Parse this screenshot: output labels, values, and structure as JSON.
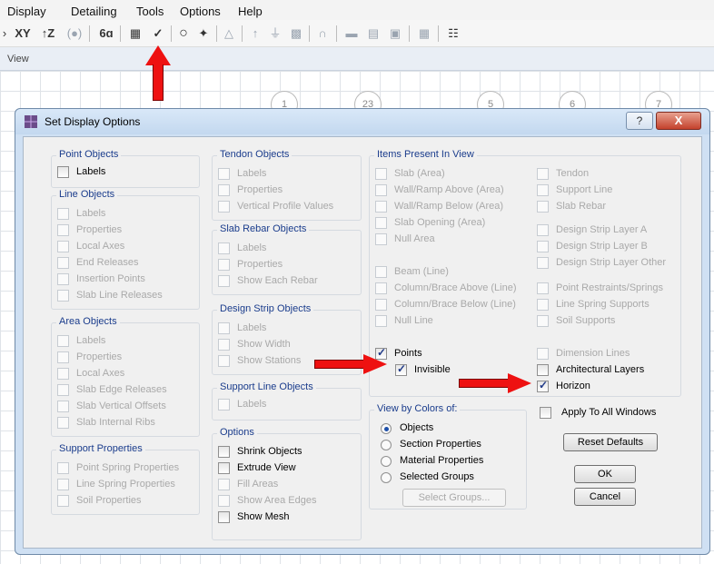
{
  "menubar": [
    "Display",
    "Detailing",
    "Tools",
    "Options",
    "Help"
  ],
  "toolbar": {
    "text_buttons": [
      "XY",
      "↑Z",
      "(●)",
      "6ɑ",
      "✓"
    ],
    "icons": [
      "pan-icon",
      "xy-view-icon",
      "z-view-icon",
      "perspective-icon",
      "rubber-band-icon",
      "display-options-icon",
      "set-display-options-icon",
      "circle-icon",
      "draw-point-icon",
      "triangle-icon",
      "column-icon",
      "beam-icon",
      "wall-icon",
      "slab-icon",
      "strip-icon",
      "rebar-icon",
      "grid-icon",
      "table-icon"
    ]
  },
  "view": {
    "title": "View"
  },
  "grid_bubbles": [
    "1",
    "23",
    "5",
    "6",
    "7"
  ],
  "dialog": {
    "title": "Set Display Options",
    "help_label": "?",
    "close_label": "X",
    "point_objects": {
      "title": "Point Objects",
      "items": [
        {
          "label": "Labels",
          "checked": false,
          "enabled": true
        }
      ]
    },
    "line_objects": {
      "title": "Line Objects",
      "items": [
        {
          "label": "Labels",
          "checked": false,
          "enabled": false
        },
        {
          "label": "Properties",
          "checked": false,
          "enabled": false
        },
        {
          "label": "Local Axes",
          "checked": false,
          "enabled": false
        },
        {
          "label": "End Releases",
          "checked": false,
          "enabled": false
        },
        {
          "label": "Insertion Points",
          "checked": false,
          "enabled": false
        },
        {
          "label": "Slab Line Releases",
          "checked": false,
          "enabled": false
        }
      ]
    },
    "area_objects": {
      "title": "Area Objects",
      "items": [
        {
          "label": "Labels",
          "checked": false,
          "enabled": false
        },
        {
          "label": "Properties",
          "checked": false,
          "enabled": false
        },
        {
          "label": "Local Axes",
          "checked": false,
          "enabled": false
        },
        {
          "label": "Slab Edge Releases",
          "checked": false,
          "enabled": false
        },
        {
          "label": "Slab Vertical Offsets",
          "checked": false,
          "enabled": false
        },
        {
          "label": "Slab Internal Ribs",
          "checked": false,
          "enabled": false
        }
      ]
    },
    "support_properties": {
      "title": "Support Properties",
      "items": [
        {
          "label": "Point Spring Properties",
          "checked": false,
          "enabled": false
        },
        {
          "label": "Line Spring Properties",
          "checked": false,
          "enabled": false
        },
        {
          "label": "Soil Properties",
          "checked": false,
          "enabled": false
        }
      ]
    },
    "tendon_objects": {
      "title": "Tendon Objects",
      "items": [
        {
          "label": "Labels",
          "checked": false,
          "enabled": false
        },
        {
          "label": "Properties",
          "checked": false,
          "enabled": false
        },
        {
          "label": "Vertical Profile Values",
          "checked": false,
          "enabled": false
        }
      ]
    },
    "slab_rebar_objects": {
      "title": "Slab Rebar Objects",
      "items": [
        {
          "label": "Labels",
          "checked": false,
          "enabled": false
        },
        {
          "label": "Properties",
          "checked": false,
          "enabled": false
        },
        {
          "label": "Show Each Rebar",
          "checked": false,
          "enabled": false
        }
      ]
    },
    "design_strip_objects": {
      "title": "Design Strip Objects",
      "items": [
        {
          "label": "Labels",
          "checked": false,
          "enabled": false
        },
        {
          "label": "Show Width",
          "checked": false,
          "enabled": false
        },
        {
          "label": "Show Stations",
          "checked": false,
          "enabled": false
        }
      ]
    },
    "support_line_objects": {
      "title": "Support Line Objects",
      "items": [
        {
          "label": "Labels",
          "checked": false,
          "enabled": false
        }
      ]
    },
    "options": {
      "title": "Options",
      "items": [
        {
          "label": "Shrink Objects",
          "checked": false,
          "enabled": true
        },
        {
          "label": "Extrude View",
          "checked": false,
          "enabled": true
        },
        {
          "label": "Fill Areas",
          "checked": false,
          "enabled": false
        },
        {
          "label": "Show Area Edges",
          "checked": false,
          "enabled": false
        },
        {
          "label": "Show Mesh",
          "checked": false,
          "enabled": true
        }
      ]
    },
    "items_present": {
      "title": "Items Present In View",
      "left": [
        {
          "label": "Slab (Area)",
          "checked": false,
          "enabled": false
        },
        {
          "label": "Wall/Ramp Above (Area)",
          "checked": false,
          "enabled": false
        },
        {
          "label": "Wall/Ramp Below (Area)",
          "checked": false,
          "enabled": false
        },
        {
          "label": "Slab Opening (Area)",
          "checked": false,
          "enabled": false
        },
        {
          "label": "Null Area",
          "checked": false,
          "enabled": false
        },
        {
          "label": "Beam (Line)",
          "checked": false,
          "enabled": false
        },
        {
          "label": "Column/Brace Above (Line)",
          "checked": false,
          "enabled": false
        },
        {
          "label": "Column/Brace Below (Line)",
          "checked": false,
          "enabled": false
        },
        {
          "label": "Null Line",
          "checked": false,
          "enabled": false
        },
        {
          "label": "Points",
          "checked": true,
          "enabled": true
        },
        {
          "label": "Invisible",
          "checked": true,
          "enabled": true
        }
      ],
      "right": [
        {
          "label": "Tendon",
          "checked": false,
          "enabled": false
        },
        {
          "label": "Support Line",
          "checked": false,
          "enabled": false
        },
        {
          "label": "Slab Rebar",
          "checked": false,
          "enabled": false
        },
        {
          "label": "Design Strip Layer A",
          "checked": false,
          "enabled": false
        },
        {
          "label": "Design Strip Layer B",
          "checked": false,
          "enabled": false
        },
        {
          "label": "Design Strip Layer Other",
          "checked": false,
          "enabled": false
        },
        {
          "label": "Point Restraints/Springs",
          "checked": false,
          "enabled": false
        },
        {
          "label": "Line Spring Supports",
          "checked": false,
          "enabled": false
        },
        {
          "label": "Soil Supports",
          "checked": false,
          "enabled": false
        },
        {
          "label": "Dimension Lines",
          "checked": false,
          "enabled": false
        },
        {
          "label": "Architectural Layers",
          "checked": false,
          "enabled": true
        },
        {
          "label": "Horizon",
          "checked": true,
          "enabled": true
        }
      ]
    },
    "view_by_colors": {
      "title": "View by Colors of:",
      "options": [
        "Objects",
        "Section Properties",
        "Material Properties",
        "Selected Groups"
      ],
      "selected": "Objects",
      "select_groups_label": "Select Groups..."
    },
    "apply_all_windows": {
      "label": "Apply To All Windows",
      "checked": false,
      "enabled": true
    },
    "reset_label": "Reset Defaults",
    "ok_label": "OK",
    "cancel_label": "Cancel"
  },
  "colors": {
    "arrow": "#ee1111",
    "group_title": "#1a3c8c",
    "dialog_frame": "#cfe0f3"
  }
}
